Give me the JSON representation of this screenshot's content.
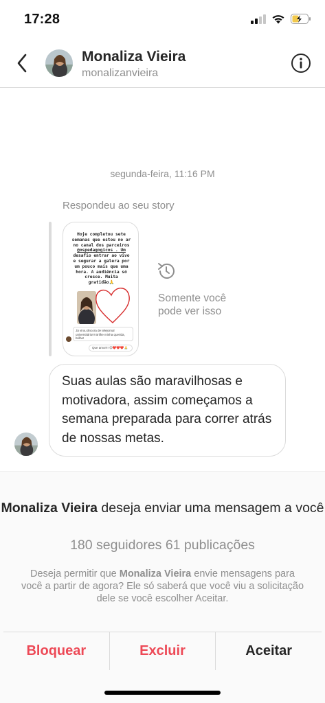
{
  "status_bar": {
    "time": "17:28"
  },
  "header": {
    "name": "Monaliza Vieira",
    "username": "monalizanvieira",
    "back_icon": "chevron-left-icon",
    "info_icon": "info-icon"
  },
  "conversation": {
    "timestamp": "segunda-feira, 11:16 PM",
    "reply_label": "Respondeu ao seu story",
    "story": {
      "text_lines": [
        "Hoje completou sete",
        "semanas que estou no ar",
        "no canal dos parceiros",
        "@ospedagogicos . Um",
        "desafio entrar ao vivo",
        "e segurar a galera por",
        "um pouco mais que uma",
        "hora. A audiência só",
        "cresce. Muita",
        "gratidão🙏"
      ],
      "comment": "Já virou âncora de telejornal universitário!!! Brilhe minha querida, brilhe!",
      "reply": "Que amor!!! 😍❤️❤️❤️🙏"
    },
    "only_you_text": "Somente você pode ver isso",
    "message": "Suas aulas são maravilhosas e motivadora, assim começamos a semana preparada para correr atrás de nossas metas."
  },
  "request": {
    "title_name": "Monaliza Vieira",
    "title_rest": " deseja enviar uma mensagem a você",
    "stats": "180 seguidores 61 publicações",
    "desc_pre": "Deseja permitir que ",
    "desc_name": "Monaliza Vieira",
    "desc_post": " envie mensagens para você a partir de agora? Ele só saberá que você viu a solicitação dele se você escolher Aceitar."
  },
  "actions": {
    "block": "Bloquear",
    "delete": "Excluir",
    "accept": "Aceitar"
  },
  "colors": {
    "danger": "#ed4956",
    "muted": "#8e8e8e",
    "text": "#262626",
    "border": "#dbdbdb"
  }
}
